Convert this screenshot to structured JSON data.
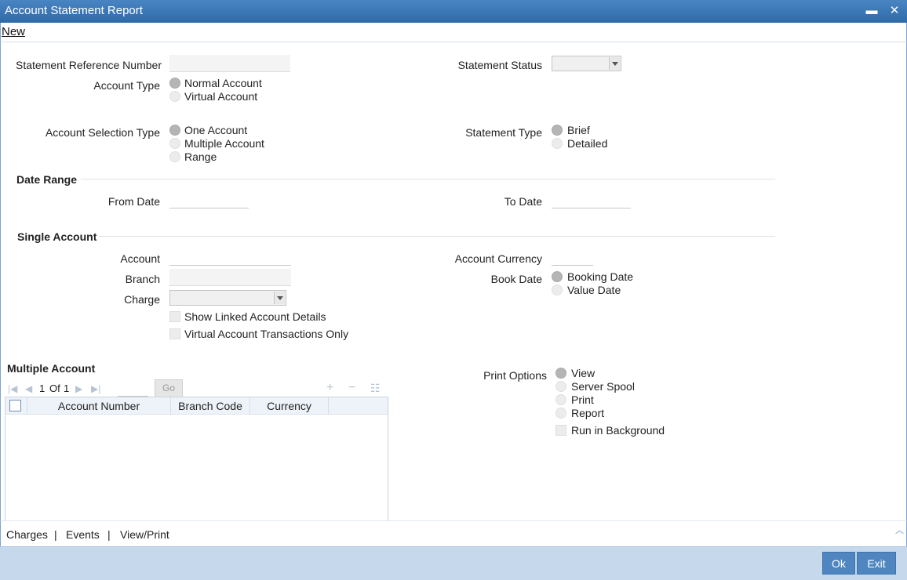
{
  "window": {
    "title": "Account Statement Report",
    "minimize_glyph": "▬",
    "close_glyph": "✕"
  },
  "menu": {
    "new_label": "New"
  },
  "fields": {
    "statement_ref_label": "Statement Reference Number",
    "statement_ref_value": "",
    "statement_status_label": "Statement Status",
    "statement_status_value": "",
    "account_type_label": "Account Type",
    "account_type_options": [
      "Normal Account",
      "Virtual Account"
    ],
    "account_type_selected": 0,
    "account_selection_type_label": "Account Selection Type",
    "account_selection_options": [
      "One Account",
      "Multiple Account",
      "Range"
    ],
    "account_selection_selected": 0,
    "statement_type_label": "Statement Type",
    "statement_type_options": [
      "Brief",
      "Detailed"
    ],
    "statement_type_selected": 0
  },
  "date_range": {
    "section_title": "Date Range",
    "from_label": "From Date",
    "from_value": "",
    "to_label": "To Date",
    "to_value": ""
  },
  "single_account": {
    "section_title": "Single Account",
    "account_label": "Account",
    "account_value": "",
    "branch_label": "Branch",
    "branch_value": "",
    "charge_label": "Charge",
    "charge_value": "",
    "account_currency_label": "Account Currency",
    "account_currency_value": "",
    "book_date_label": "Book Date",
    "book_date_options": [
      "Booking Date",
      "Value Date"
    ],
    "book_date_selected": 0,
    "show_linked_label": "Show Linked Account Details",
    "virtual_only_label": "Virtual Account Transactions Only"
  },
  "multiple_account": {
    "section_title": "Multiple Account",
    "page_current": "1",
    "page_of": "Of",
    "page_total": "1",
    "go_label": "Go",
    "columns": [
      "Account Number",
      "Branch Code",
      "Currency"
    ],
    "rows": []
  },
  "print_options": {
    "label": "Print Options",
    "options": [
      "View",
      "Server Spool",
      "Print",
      "Report"
    ],
    "selected": 0,
    "run_background_label": "Run in Background"
  },
  "bottom_tabs": {
    "charges": "Charges",
    "events": "Events",
    "view_print": "View/Print",
    "separator": "|"
  },
  "footer": {
    "ok_label": "Ok",
    "exit_label": "Exit"
  },
  "colors": {
    "titlebar": "#3a76b5",
    "footer": "#c6d9ec",
    "button": "#4f86c0"
  },
  "icons": {
    "first": "first-page-icon",
    "prev": "previous-page-icon",
    "next": "next-page-icon",
    "last": "last-page-icon",
    "add": "add-row-icon",
    "delete": "delete-row-icon",
    "single_view": "single-view-icon",
    "collapse": "collapse-chevron-icon"
  }
}
